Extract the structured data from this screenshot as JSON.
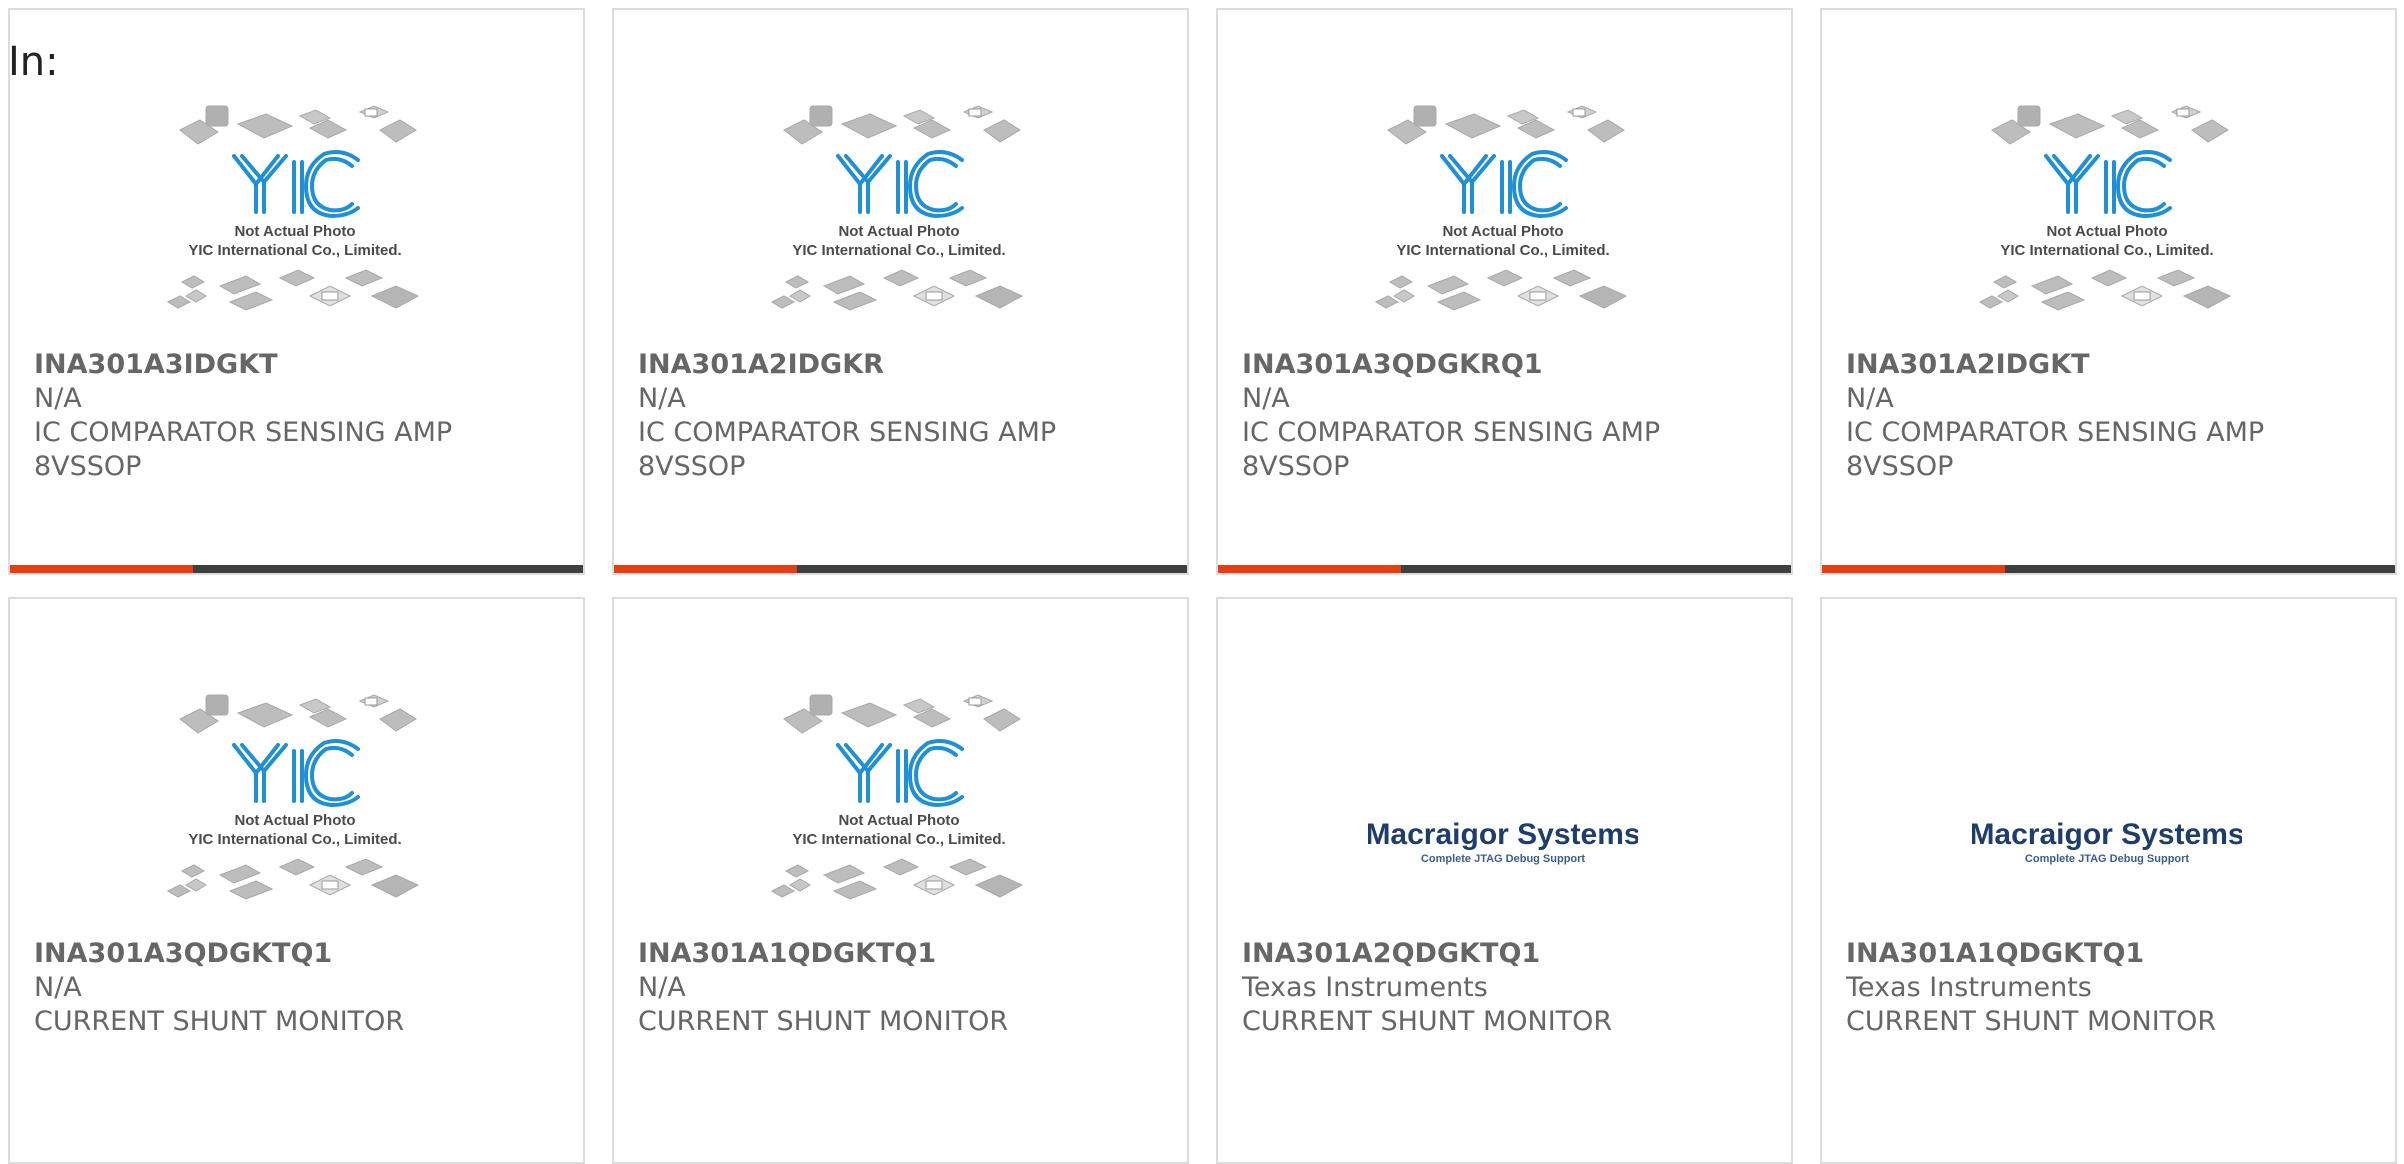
{
  "header": {
    "in_label": "In:"
  },
  "products": [
    {
      "part": "INA301A3IDGKT",
      "manufacturer": "N/A",
      "desc1": "IC COMPARATOR SENSING AMP",
      "desc2": "8VSSOP",
      "image": "yic-placeholder",
      "img_line1": "Not Actual Photo",
      "img_line2": "YIC International Co., Limited.",
      "img_logo": "YIC"
    },
    {
      "part": "INA301A2IDGKR",
      "manufacturer": "N/A",
      "desc1": "IC COMPARATOR SENSING AMP",
      "desc2": "8VSSOP",
      "image": "yic-placeholder",
      "img_line1": "Not Actual Photo",
      "img_line2": "YIC International Co., Limited.",
      "img_logo": "YIC"
    },
    {
      "part": "INA301A3QDGKRQ1",
      "manufacturer": "N/A",
      "desc1": "IC COMPARATOR SENSING AMP",
      "desc2": "8VSSOP",
      "image": "yic-placeholder",
      "img_line1": "Not Actual Photo",
      "img_line2": "YIC International Co., Limited.",
      "img_logo": "YIC"
    },
    {
      "part": "INA301A2IDGKT",
      "manufacturer": "N/A",
      "desc1": "IC COMPARATOR SENSING AMP",
      "desc2": "8VSSOP",
      "image": "yic-placeholder",
      "img_line1": "Not Actual Photo",
      "img_line2": "YIC International Co., Limited.",
      "img_logo": "YIC"
    },
    {
      "part": "INA301A3QDGKTQ1",
      "manufacturer": "N/A",
      "desc1": "CURRENT SHUNT MONITOR",
      "desc2": "",
      "image": "yic-placeholder",
      "img_line1": "Not Actual Photo",
      "img_line2": "YIC International Co., Limited.",
      "img_logo": "YIC"
    },
    {
      "part": "INA301A1QDGKTQ1",
      "manufacturer": "N/A",
      "desc1": "CURRENT SHUNT MONITOR",
      "desc2": "",
      "image": "yic-placeholder",
      "img_line1": "Not Actual Photo",
      "img_line2": "YIC International Co., Limited.",
      "img_logo": "YIC"
    },
    {
      "part": "INA301A2QDGKTQ1",
      "manufacturer": "Texas Instruments",
      "desc1": "CURRENT SHUNT MONITOR",
      "desc2": "",
      "image": "macraigor-logo",
      "img_line1": "Macraigor Systems",
      "img_line2": "Complete JTAG Debug Support"
    },
    {
      "part": "INA301A1QDGKTQ1",
      "manufacturer": "Texas Instruments",
      "desc1": "CURRENT SHUNT MONITOR",
      "desc2": "",
      "image": "macraigor-logo",
      "img_line1": "Macraigor Systems",
      "img_line2": "Complete JTAG Debug Support"
    }
  ],
  "colors": {
    "accent": "#e63e12",
    "bar": "#3f3f3f",
    "text": "#666666",
    "border": "#dcdcdc",
    "yic_blue": "#1f8fd8"
  }
}
